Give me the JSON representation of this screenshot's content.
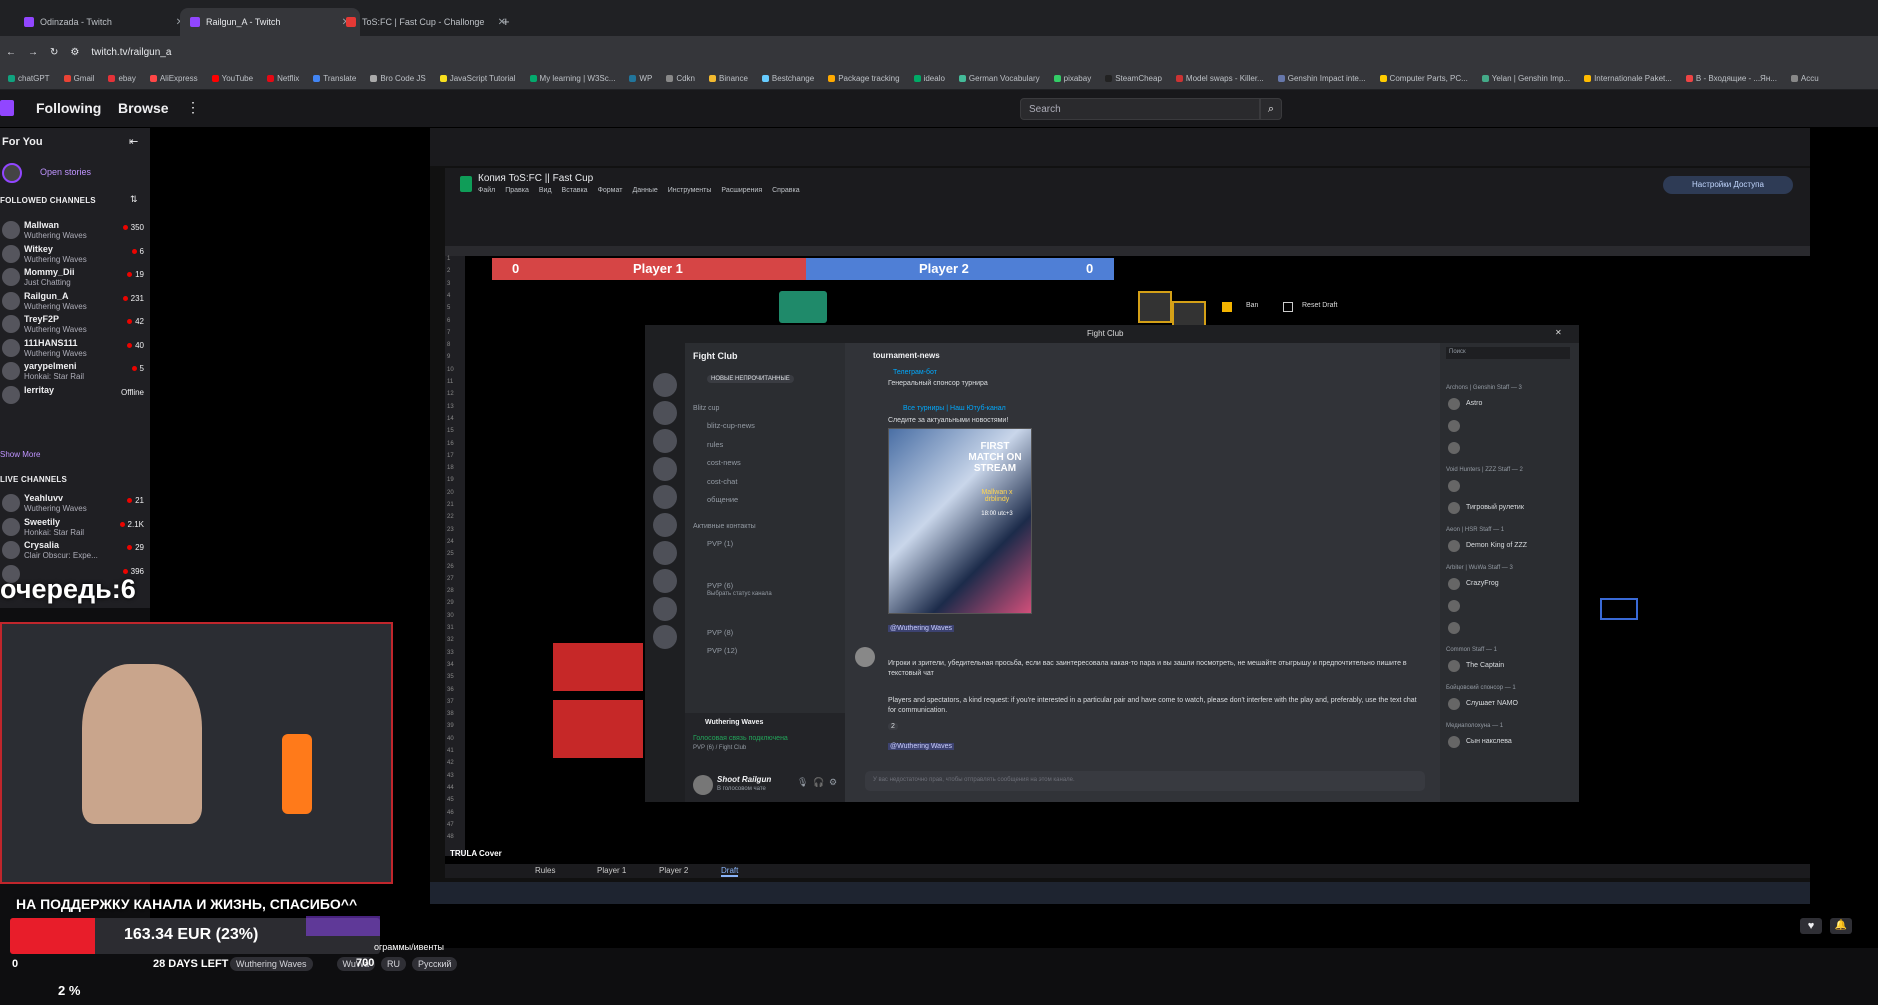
{
  "browser": {
    "tabs": [
      {
        "label": "Odinzada - Twitch",
        "active": false
      },
      {
        "label": "Railgun_A - Twitch",
        "active": true
      },
      {
        "label": "ToS:FC | Fast Cup - Challonge",
        "active": false
      }
    ],
    "new_tab": "+",
    "address": "twitch.tv/railgun_a",
    "bookmarks": [
      "chatGPT",
      "Gmail",
      "ebay",
      "AliExpress",
      "YouTube",
      "Netflix",
      "Translate",
      "Bro Code JS",
      "JavaScript Tutorial",
      "My learning | W3Sc...",
      "WP",
      "Cdkn",
      "Binance",
      "Bestchange",
      "Package tracking",
      "idealo",
      "German Vocabulary",
      "pixabay",
      "SteamCheap",
      "Model swaps - Killer...",
      "Genshin Impact inte...",
      "Computer Parts, PC...",
      "Yelan | Genshin Imp...",
      "Internationale Paket...",
      "В - Входящие - ...Ян...",
      "Accu"
    ]
  },
  "twitch": {
    "nav": {
      "following": "Following",
      "browse": "Browse",
      "more": "⋮"
    },
    "search_placeholder": "Search",
    "sidebar": {
      "for_you": "For You",
      "open_stories": "Open stories",
      "followed_heading": "FOLLOWED CHANNELS",
      "followed": [
        {
          "name": "Mallwan",
          "game": "Wuthering Waves",
          "viewers": "350"
        },
        {
          "name": "Witkey",
          "game": "Wuthering Waves",
          "viewers": "6"
        },
        {
          "name": "Mommy_Dii",
          "game": "Just Chatting",
          "viewers": "19"
        },
        {
          "name": "Railgun_A",
          "game": "Wuthering Waves",
          "viewers": "231"
        },
        {
          "name": "TreyF2P",
          "game": "Wuthering Waves",
          "viewers": "42"
        },
        {
          "name": "111HANS111",
          "game": "Wuthering Waves",
          "viewers": "40"
        },
        {
          "name": "yarypelmeni",
          "game": "Honkai: Star Rail",
          "viewers": "5"
        },
        {
          "name": "lerritay",
          "game": "",
          "viewers": "Offline"
        }
      ],
      "show_more": "Show More",
      "live_heading": "LIVE CHANNELS",
      "live": [
        {
          "name": "Yeahluvv",
          "game": "Wuthering Waves",
          "viewers": "21"
        },
        {
          "name": "Sweetily",
          "game": "Honkai: Star Rail",
          "viewers": "2.1K"
        },
        {
          "name": "Crysalia",
          "game": "Clair Obscur: Expe...",
          "viewers": "29"
        },
        {
          "name": "",
          "game": "",
          "viewers": "396"
        }
      ]
    }
  },
  "overlay": {
    "queue": "очередь:6",
    "donation_text": "НА ПОДДЕРЖКУ КАНАЛА И ЖИЗНЬ, СПАСИБО^^",
    "goal_amount": "163.34 EUR (23%)",
    "goal_progress": 0.23,
    "goal_start": "0",
    "days_left": "28 DAYS LEFT",
    "goal_end": "700",
    "percent": "2 %",
    "stream_sub": "ограммы/ивенты"
  },
  "stream_tags": [
    "Wuthering Waves",
    "WuWa",
    "RU",
    "Русский"
  ],
  "sheet": {
    "title": "Копия ToS:FC || Fast Cup",
    "menu": [
      "Файл",
      "Правка",
      "Вид",
      "Вставка",
      "Формат",
      "Данные",
      "Инструменты",
      "Расширения",
      "Справка"
    ],
    "share": "Настройки Доступа",
    "player1": {
      "label": "Player 1",
      "score": "0"
    },
    "player2": {
      "label": "Player 2",
      "score": "0"
    },
    "ban": "Ban",
    "reset": "Reset Draft",
    "sheet_tabs": [
      "Rules",
      "Player 1",
      "Player 2",
      "Draft"
    ],
    "cover": "TRULA Cover"
  },
  "discord": {
    "window_title": "Fight Club",
    "server": "Fight Club",
    "channel": "tournament-news",
    "new_unread": "НОВЫЕ НЕПРОЧИТАННЫЕ",
    "category": "Blitz cup",
    "channels": [
      "blitz-cup-news",
      "rules",
      "cost-news",
      "cost-chat",
      "общение"
    ],
    "voice_heading": "Активные контакты",
    "voice": [
      "PVP (1)",
      "PVP (6)",
      "PVP (8)",
      "PVP (12)"
    ],
    "voice_status": "Выбрать статус канала",
    "voice_server": "Wuthering Waves",
    "voice_connected": "Голосовая связь подключена",
    "voice_channel": "PVP (6) / Fight Club",
    "user": "Shoot Railgun",
    "user_status": "В голосовом чате",
    "messages": {
      "bot": "Телеграм-бот",
      "sponsor": "Генеральный спонсор турнира",
      "links": "Все турниры | Наш Ютуб-канал",
      "news": "Следите за актуальными новостями!",
      "poster_title": "FIRST MATCH ON STREAM",
      "poster_sub": "Mallwan x drblindy",
      "poster_time": "18:00 utc+3",
      "mention": "@Wuthering Waves",
      "ru_text": "Игроки и зрители, убедительная просьба, если вас заинтересовала какая-то пара и вы зашли посмотреть, не мешайте отыгрышу и предпочтительно пишите в текстовый чат",
      "en_text": "Players and spectators, a kind request: if you're interested in a particular pair and have come to watch, please don't interfere with the play and, preferably, use the text chat for communication.",
      "reactions": "2",
      "no_perm": "У вас недостаточно прав, чтобы отправлять сообщения на этом канале."
    },
    "member_search": "Поиск",
    "member_groups": [
      {
        "label": "Archons | Genshin Staff — 3",
        "members": [
          "Astro",
          "",
          ""
        ]
      },
      {
        "label": "Void Hunters | ZZZ Staff — 2",
        "members": [
          "",
          "Тигровый рулетик"
        ]
      },
      {
        "label": "Aeon | HSR Staff — 1",
        "members": [
          "Demon King of ZZZ"
        ]
      },
      {
        "label": "Arbiter | WuWa Staff — 3",
        "members": [
          "CrazyFrog",
          "",
          ""
        ]
      },
      {
        "label": "Common Staff — 1",
        "members": [
          "The Captain"
        ]
      },
      {
        "label": "Бойцовский спонсор — 1",
        "members": [
          "Слушает NAMO"
        ]
      },
      {
        "label": "Медиаполохуна — 1",
        "members": [
          "Сын накслева"
        ]
      }
    ]
  }
}
